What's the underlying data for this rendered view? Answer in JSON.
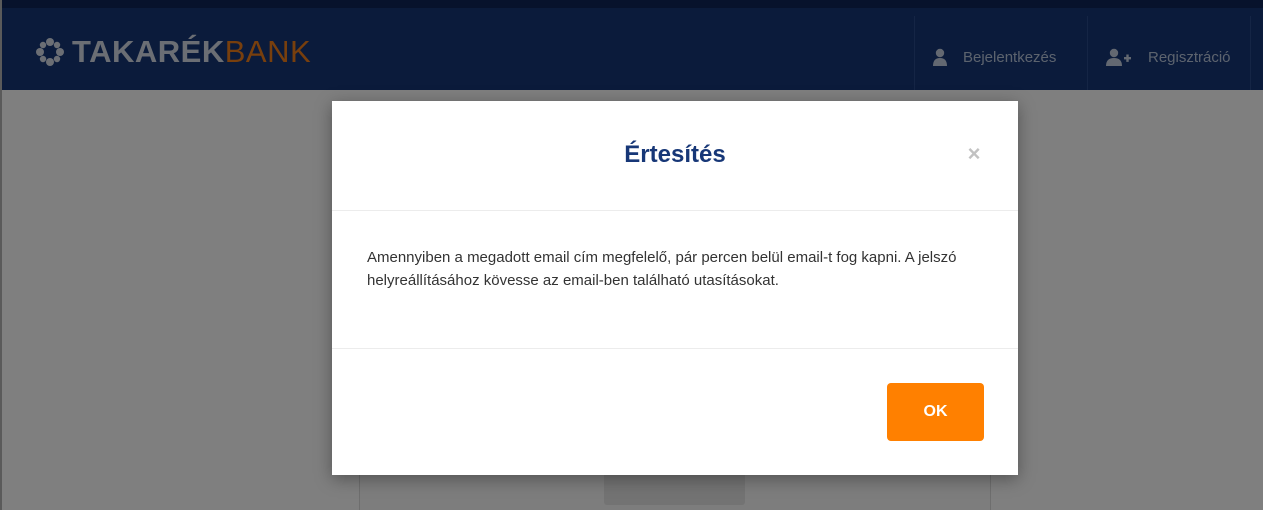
{
  "header": {
    "logo_text_part1": "TAKARÉK",
    "logo_text_part2": "BANK",
    "logo_icon": "flower-icon",
    "login": {
      "label": "Bejelentkezés",
      "icon": "user-icon"
    },
    "register": {
      "label": "Regisztráció",
      "icon": "user-add-icon"
    }
  },
  "modal": {
    "title": "Értesítés",
    "close_label": "×",
    "message": "Amennyiben a megadott email cím megfelelő, pár percen belül email-t fog kapni. A jelszó helyreállításához kövesse az email-ben található utasításokat.",
    "ok_label": "OK"
  },
  "colors": {
    "navbar": "#173777",
    "title": "#173777",
    "accent": "#ff8000",
    "logo_orange": "#f07f1b"
  }
}
